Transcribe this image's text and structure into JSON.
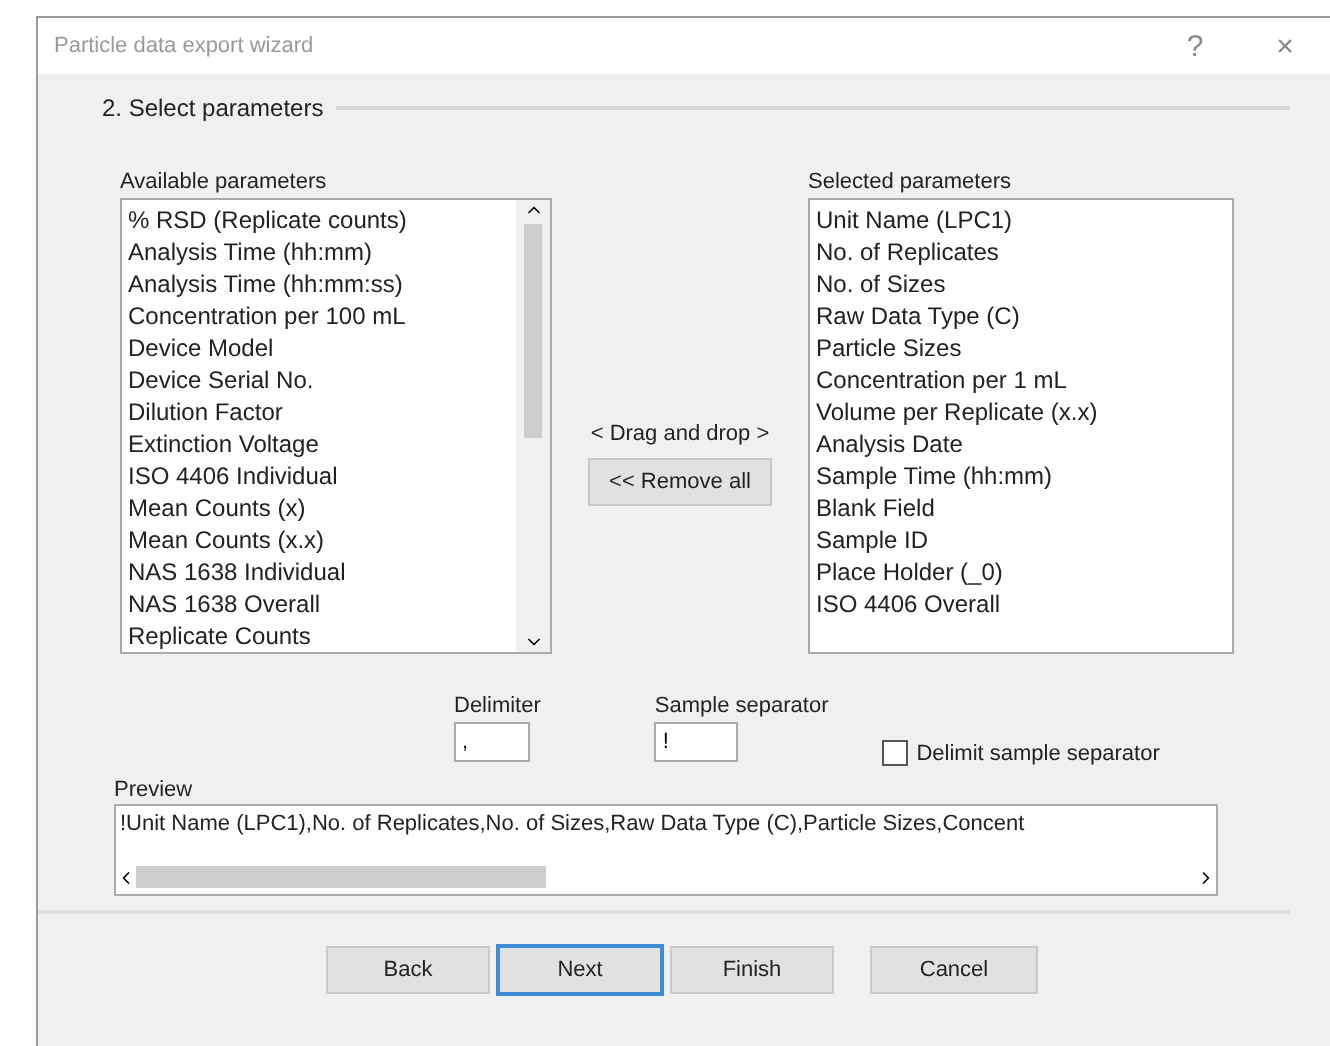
{
  "window": {
    "title": "Particle data export wizard",
    "help": "?",
    "close": "×"
  },
  "step": {
    "title": "2. Select parameters"
  },
  "available": {
    "label": "Available parameters",
    "items": [
      "% RSD (Replicate counts)",
      "Analysis Time (hh:mm)",
      "Analysis Time (hh:mm:ss)",
      "Concentration per 100 mL",
      "Device Model",
      "Device Serial No.",
      "Dilution Factor",
      "Extinction Voltage",
      "ISO 4406 Individual",
      "Mean Counts (x)",
      "Mean Counts (x.x)",
      "NAS 1638 Individual",
      "NAS 1638 Overall",
      "Replicate Counts"
    ]
  },
  "middle": {
    "hint": "< Drag and drop >",
    "remove_all": "<< Remove all"
  },
  "selected": {
    "label": "Selected parameters",
    "items": [
      "Unit Name (LPC1)",
      "No. of Replicates",
      "No. of Sizes",
      "Raw Data Type (C)",
      "Particle Sizes",
      "Concentration per 1 mL",
      "Volume per Replicate (x.x)",
      "Analysis Date",
      "Sample Time (hh:mm)",
      "Blank Field",
      "Sample ID",
      "Place Holder (_0)",
      "ISO 4406 Overall"
    ]
  },
  "delimiter": {
    "label": "Delimiter",
    "value": ","
  },
  "sample_separator": {
    "label": "Sample separator",
    "value": "!"
  },
  "delimit_sample_separator": {
    "label": "Delimit sample separator",
    "checked": false
  },
  "preview": {
    "label": "Preview",
    "text": "!Unit Name (LPC1),No. of Replicates,No. of Sizes,Raw Data Type (C),Particle Sizes,Concent"
  },
  "buttons": [
    {
      "label": "Back",
      "focused": false
    },
    {
      "label": "Next",
      "focused": true
    },
    {
      "label": "Finish",
      "focused": false
    },
    {
      "label": "Cancel",
      "focused": false
    }
  ]
}
